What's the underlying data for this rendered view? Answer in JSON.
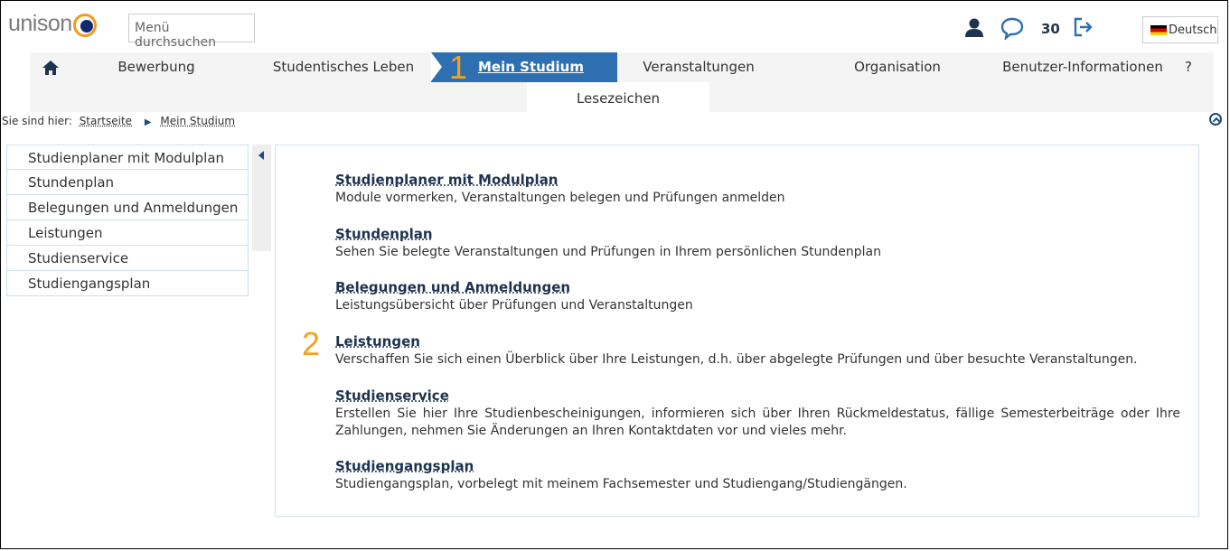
{
  "app": {
    "logo_text": "unison"
  },
  "search": {
    "placeholder": "Menü durchsuchen"
  },
  "header": {
    "message_count": "30",
    "language": "Deutsch"
  },
  "nav": {
    "home_icon": "home-icon",
    "items": [
      "Bewerbung",
      "Studentisches Leben",
      "Mein Studium",
      "Veranstaltungen",
      "Organisation",
      "Benutzer-Informationen",
      "?"
    ],
    "active": "Mein Studium"
  },
  "subnav": {
    "tab": "Lesezeichen"
  },
  "annotations": {
    "marker1": "1",
    "marker2": "2"
  },
  "breadcrumb": {
    "prefix": "Sie sind hier:",
    "items": [
      "Startseite",
      "Mein Studium"
    ]
  },
  "sidebar": {
    "items": [
      "Studienplaner mit Modulplan",
      "Stundenplan",
      "Belegungen und Anmeldungen",
      "Leistungen",
      "Studienservice",
      "Studiengangsplan"
    ]
  },
  "content": {
    "entries": [
      {
        "title": "Studienplaner mit Modulplan",
        "desc": "Module vormerken, Veranstaltungen belegen und Prüfungen anmelden"
      },
      {
        "title": "Stundenplan",
        "desc": "Sehen Sie belegte Veranstaltungen und Prüfungen in Ihrem persönlichen Stundenplan"
      },
      {
        "title": "Belegungen und Anmeldungen",
        "desc": "Leistungsübersicht über Prüfungen und Veranstaltungen"
      },
      {
        "title": "Leistungen",
        "desc": "Verschaffen Sie sich einen Überblick über Ihre Leistungen, d.h. über abgelegte Prüfungen und über besuchte Veranstaltungen."
      },
      {
        "title": "Studienservice",
        "desc": "Erstellen Sie hier Ihre Studienbescheinigungen, informieren sich über Ihren Rückmeldestatus, fällige Semesterbeiträge oder Ihre Zahlungen, nehmen Sie Änderungen an Ihren Kontaktdaten vor und vieles mehr."
      },
      {
        "title": "Studiengangsplan",
        "desc": "Studiengangsplan, vorbelegt mit meinem Fachsemester und Studiengang/Studiengängen."
      }
    ]
  },
  "colors": {
    "accent": "#2d6fb0",
    "brand_orange": "#f39a1e",
    "brand_navy": "#112a6d",
    "link": "#1e3350",
    "marker": "#f3a21c"
  }
}
